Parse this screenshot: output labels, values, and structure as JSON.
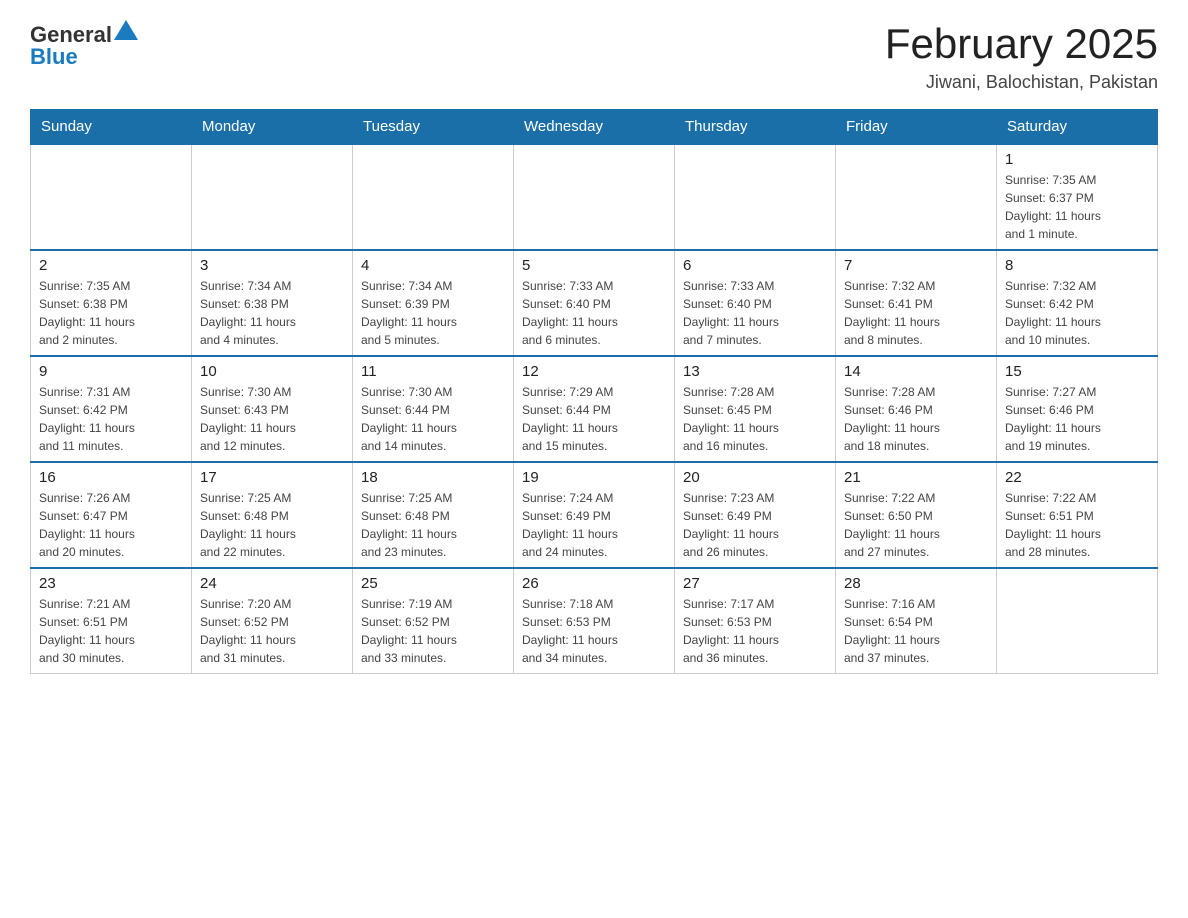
{
  "header": {
    "logo_general": "General",
    "logo_blue": "Blue",
    "month_title": "February 2025",
    "location": "Jiwani, Balochistan, Pakistan"
  },
  "weekdays": [
    "Sunday",
    "Monday",
    "Tuesday",
    "Wednesday",
    "Thursday",
    "Friday",
    "Saturday"
  ],
  "weeks": [
    [
      {
        "day": "",
        "info": ""
      },
      {
        "day": "",
        "info": ""
      },
      {
        "day": "",
        "info": ""
      },
      {
        "day": "",
        "info": ""
      },
      {
        "day": "",
        "info": ""
      },
      {
        "day": "",
        "info": ""
      },
      {
        "day": "1",
        "info": "Sunrise: 7:35 AM\nSunset: 6:37 PM\nDaylight: 11 hours\nand 1 minute."
      }
    ],
    [
      {
        "day": "2",
        "info": "Sunrise: 7:35 AM\nSunset: 6:38 PM\nDaylight: 11 hours\nand 2 minutes."
      },
      {
        "day": "3",
        "info": "Sunrise: 7:34 AM\nSunset: 6:38 PM\nDaylight: 11 hours\nand 4 minutes."
      },
      {
        "day": "4",
        "info": "Sunrise: 7:34 AM\nSunset: 6:39 PM\nDaylight: 11 hours\nand 5 minutes."
      },
      {
        "day": "5",
        "info": "Sunrise: 7:33 AM\nSunset: 6:40 PM\nDaylight: 11 hours\nand 6 minutes."
      },
      {
        "day": "6",
        "info": "Sunrise: 7:33 AM\nSunset: 6:40 PM\nDaylight: 11 hours\nand 7 minutes."
      },
      {
        "day": "7",
        "info": "Sunrise: 7:32 AM\nSunset: 6:41 PM\nDaylight: 11 hours\nand 8 minutes."
      },
      {
        "day": "8",
        "info": "Sunrise: 7:32 AM\nSunset: 6:42 PM\nDaylight: 11 hours\nand 10 minutes."
      }
    ],
    [
      {
        "day": "9",
        "info": "Sunrise: 7:31 AM\nSunset: 6:42 PM\nDaylight: 11 hours\nand 11 minutes."
      },
      {
        "day": "10",
        "info": "Sunrise: 7:30 AM\nSunset: 6:43 PM\nDaylight: 11 hours\nand 12 minutes."
      },
      {
        "day": "11",
        "info": "Sunrise: 7:30 AM\nSunset: 6:44 PM\nDaylight: 11 hours\nand 14 minutes."
      },
      {
        "day": "12",
        "info": "Sunrise: 7:29 AM\nSunset: 6:44 PM\nDaylight: 11 hours\nand 15 minutes."
      },
      {
        "day": "13",
        "info": "Sunrise: 7:28 AM\nSunset: 6:45 PM\nDaylight: 11 hours\nand 16 minutes."
      },
      {
        "day": "14",
        "info": "Sunrise: 7:28 AM\nSunset: 6:46 PM\nDaylight: 11 hours\nand 18 minutes."
      },
      {
        "day": "15",
        "info": "Sunrise: 7:27 AM\nSunset: 6:46 PM\nDaylight: 11 hours\nand 19 minutes."
      }
    ],
    [
      {
        "day": "16",
        "info": "Sunrise: 7:26 AM\nSunset: 6:47 PM\nDaylight: 11 hours\nand 20 minutes."
      },
      {
        "day": "17",
        "info": "Sunrise: 7:25 AM\nSunset: 6:48 PM\nDaylight: 11 hours\nand 22 minutes."
      },
      {
        "day": "18",
        "info": "Sunrise: 7:25 AM\nSunset: 6:48 PM\nDaylight: 11 hours\nand 23 minutes."
      },
      {
        "day": "19",
        "info": "Sunrise: 7:24 AM\nSunset: 6:49 PM\nDaylight: 11 hours\nand 24 minutes."
      },
      {
        "day": "20",
        "info": "Sunrise: 7:23 AM\nSunset: 6:49 PM\nDaylight: 11 hours\nand 26 minutes."
      },
      {
        "day": "21",
        "info": "Sunrise: 7:22 AM\nSunset: 6:50 PM\nDaylight: 11 hours\nand 27 minutes."
      },
      {
        "day": "22",
        "info": "Sunrise: 7:22 AM\nSunset: 6:51 PM\nDaylight: 11 hours\nand 28 minutes."
      }
    ],
    [
      {
        "day": "23",
        "info": "Sunrise: 7:21 AM\nSunset: 6:51 PM\nDaylight: 11 hours\nand 30 minutes."
      },
      {
        "day": "24",
        "info": "Sunrise: 7:20 AM\nSunset: 6:52 PM\nDaylight: 11 hours\nand 31 minutes."
      },
      {
        "day": "25",
        "info": "Sunrise: 7:19 AM\nSunset: 6:52 PM\nDaylight: 11 hours\nand 33 minutes."
      },
      {
        "day": "26",
        "info": "Sunrise: 7:18 AM\nSunset: 6:53 PM\nDaylight: 11 hours\nand 34 minutes."
      },
      {
        "day": "27",
        "info": "Sunrise: 7:17 AM\nSunset: 6:53 PM\nDaylight: 11 hours\nand 36 minutes."
      },
      {
        "day": "28",
        "info": "Sunrise: 7:16 AM\nSunset: 6:54 PM\nDaylight: 11 hours\nand 37 minutes."
      },
      {
        "day": "",
        "info": ""
      }
    ]
  ]
}
